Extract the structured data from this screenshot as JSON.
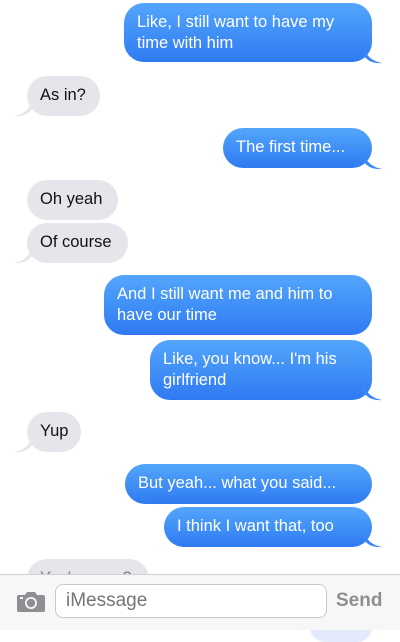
{
  "messages": [
    {
      "dir": "out",
      "text": "Like, I still want to have my time with him"
    },
    {
      "dir": "in",
      "text": "As in?"
    },
    {
      "dir": "out",
      "text": "The first time..."
    },
    {
      "dir": "in",
      "text": "Oh yeah"
    },
    {
      "dir": "in",
      "text": "Of course"
    },
    {
      "dir": "out",
      "text": "And I still want me and him to have our time"
    },
    {
      "dir": "out",
      "text": "Like, you know... I'm his girlfriend"
    },
    {
      "dir": "in",
      "text": "Yup"
    },
    {
      "dir": "out",
      "text": "But yeah... what you said..."
    },
    {
      "dir": "out",
      "text": "I think I want that, too"
    },
    {
      "dir": "in",
      "text": "You're sure?"
    }
  ],
  "composer": {
    "placeholder": "iMessage",
    "send_label": "Send",
    "camera_icon": "camera-icon"
  },
  "colors": {
    "incoming": "#e6e5eb",
    "outgoing_top": "#53a6fb",
    "outgoing_bottom": "#2f7af2"
  }
}
